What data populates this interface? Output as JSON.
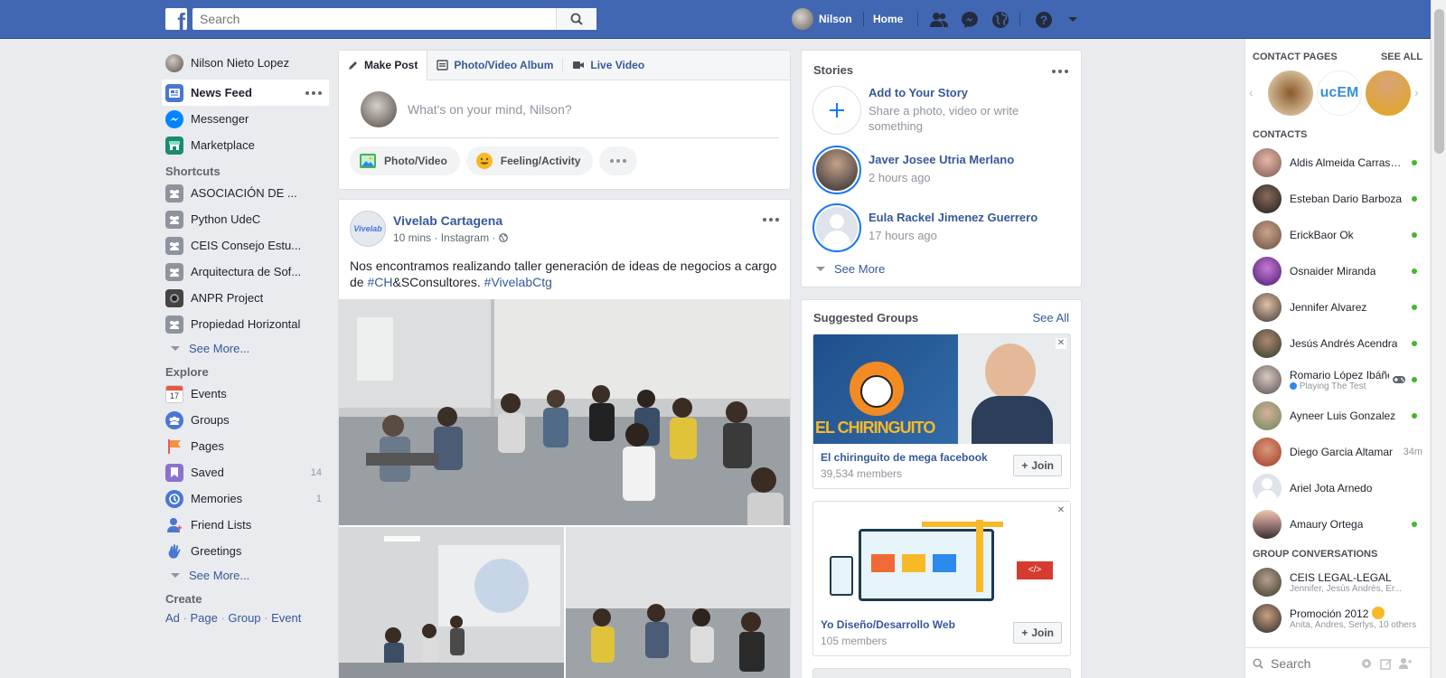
{
  "topbar": {
    "logo": "f",
    "search_placeholder": "Search",
    "user_name": "Nilson",
    "home_label": "Home"
  },
  "left_nav": {
    "profile_name": "Nilson Nieto Lopez",
    "main_items": [
      {
        "label": "News Feed",
        "icon": "news-feed-icon",
        "active": true
      },
      {
        "label": "Messenger",
        "icon": "messenger-icon"
      },
      {
        "label": "Marketplace",
        "icon": "marketplace-icon"
      }
    ],
    "shortcuts_heading": "Shortcuts",
    "shortcuts": [
      {
        "label": "ASOCIACIÓN DE ..."
      },
      {
        "label": "Python UdeC"
      },
      {
        "label": "CEIS Consejo Estu..."
      },
      {
        "label": "Arquitectura de Sof..."
      },
      {
        "label": "ANPR Project"
      },
      {
        "label": "Propiedad Horizontal"
      }
    ],
    "see_more_label": "See More...",
    "explore_heading": "Explore",
    "explore": [
      {
        "label": "Events",
        "icon": "calendar-icon",
        "count": "",
        "date": "17"
      },
      {
        "label": "Groups",
        "icon": "groups-icon",
        "count": ""
      },
      {
        "label": "Pages",
        "icon": "flag-icon",
        "count": ""
      },
      {
        "label": "Saved",
        "icon": "bookmark-icon",
        "count": "14"
      },
      {
        "label": "Memories",
        "icon": "clock-icon",
        "count": "1"
      },
      {
        "label": "Friend Lists",
        "icon": "friends-icon",
        "count": ""
      },
      {
        "label": "Greetings",
        "icon": "wave-hand-icon",
        "count": ""
      }
    ],
    "see_more_label2": "See More...",
    "create_heading": "Create",
    "create_links": [
      "Ad",
      "Page",
      "Group",
      "Event"
    ]
  },
  "composer": {
    "tabs": [
      "Make Post",
      "Photo/Video Album",
      "Live Video"
    ],
    "placeholder": "What's on your mind, Nilson?",
    "buttons": [
      "Photo/Video",
      "Feeling/Activity"
    ]
  },
  "post": {
    "author": "Vivelab Cartagena",
    "avatar_text": "Vivelab",
    "time": "10 mins",
    "source": "Instagram",
    "text_before": "Nos encontramos realizando taller generación de ideas de negocios a cargo de ",
    "hashtag1": "#CH",
    "text_mid": "&SConsultores. ",
    "hashtag2": "#VivelabCtg"
  },
  "stories": {
    "title": "Stories",
    "add_title": "Add to Your Story",
    "add_sub": "Share a photo, video or write something",
    "items": [
      {
        "name": "Javer Josee Utria Merlano",
        "time": "2 hours ago"
      },
      {
        "name": "Eula Rackel Jimenez Guerrero",
        "time": "17 hours ago"
      }
    ],
    "see_more": "See More"
  },
  "suggested_groups": {
    "title": "Suggested Groups",
    "see_all": "See All",
    "groups": [
      {
        "name": "El chiringuito de mega facebook",
        "members": "39,534 members",
        "banner_text": "EL CHIRINGUITO"
      },
      {
        "name": "Yo Diseño/Desarrollo Web",
        "members": "105 members",
        "banner_text": ""
      }
    ],
    "join_label": "Join"
  },
  "right_panel": {
    "contact_pages_heading": "CONTACT PAGES",
    "see_all": "SEE ALL",
    "contact_page_logo_text": "ucEM",
    "contacts_heading": "CONTACTS",
    "contacts": [
      {
        "name": "Aldis Almeida Carrasquilla",
        "status": "online"
      },
      {
        "name": "Esteban Dario Barboza",
        "status": "online"
      },
      {
        "name": "ErickBaor Ok",
        "status": "online"
      },
      {
        "name": "Osnaider Miranda",
        "status": "online"
      },
      {
        "name": "Jennifer Alvarez",
        "status": "online"
      },
      {
        "name": "Jesús Andrés Acendra",
        "status": "online"
      },
      {
        "name": "Romario López Ibáñez",
        "status": "online",
        "sub": "Playing The Test"
      },
      {
        "name": "Ayneer Luis Gonzalez",
        "status": "online"
      },
      {
        "name": "Diego Garcia Altamar",
        "status": "34m"
      },
      {
        "name": "Ariel Jota Arnedo",
        "status": ""
      },
      {
        "name": "Amaury Ortega",
        "status": "online"
      }
    ],
    "group_heading": "GROUP CONVERSATIONS",
    "groups": [
      {
        "name": "CEIS LEGAL-LEGAL",
        "sub": "Jennifer, Jesús Andrés, Er..."
      },
      {
        "name": "Promoción 2012",
        "sub": "Anita, Andres, Serlys, 10 others"
      }
    ],
    "search_placeholder": "Search"
  }
}
